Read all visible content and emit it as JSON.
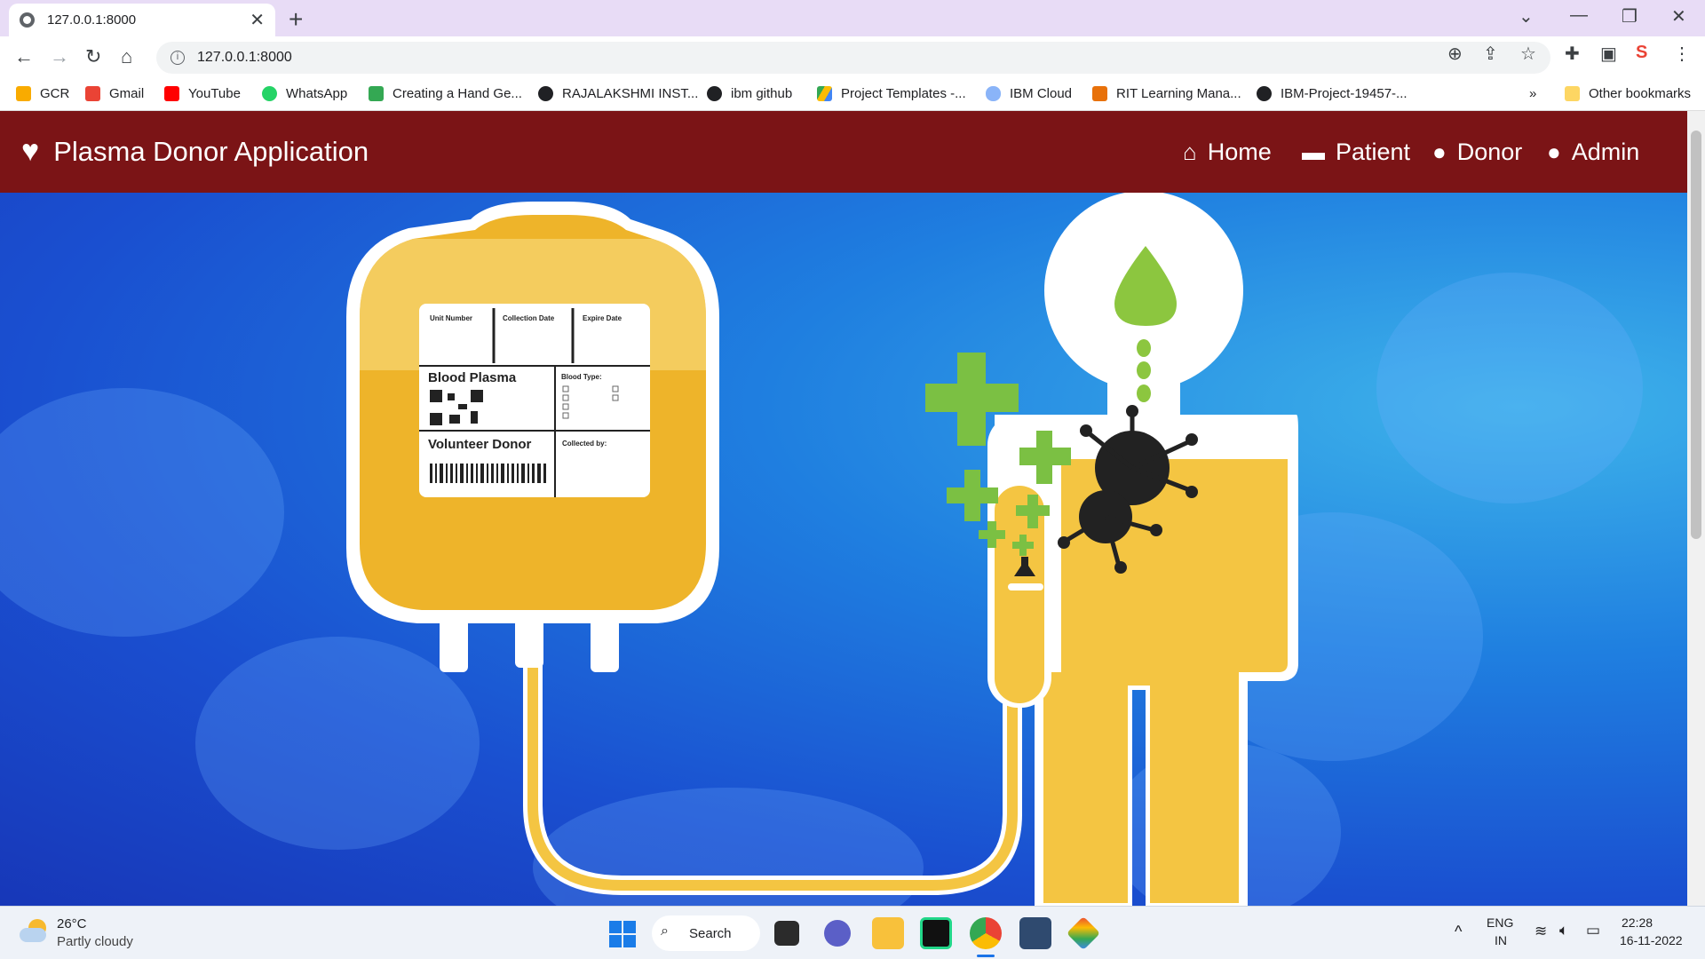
{
  "browser": {
    "tab_title": "127.0.0.1:8000",
    "url": "127.0.0.1:8000",
    "bookmarks": [
      {
        "label": "GCR",
        "color": "#f9ab00"
      },
      {
        "label": "Gmail",
        "color": "#ea4335"
      },
      {
        "label": "YouTube",
        "color": "#ff0000"
      },
      {
        "label": "WhatsApp",
        "color": "#25d366"
      },
      {
        "label": "Creating a Hand Ge...",
        "color": "#34a853"
      },
      {
        "label": "RAJALAKSHMI INST...",
        "color": "#202124"
      },
      {
        "label": "ibm github",
        "color": "#202124"
      },
      {
        "label": "Project Templates -...",
        "color": "#fbbc04"
      },
      {
        "label": "IBM Cloud",
        "color": "#8ab4f8"
      },
      {
        "label": "RIT Learning Mana...",
        "color": "#e8710a"
      },
      {
        "label": "IBM-Project-19457-...",
        "color": "#202124"
      }
    ],
    "more_bookmarks": "»",
    "other_bookmarks": "Other bookmarks"
  },
  "app": {
    "brand": "Plasma Donor Application",
    "nav": [
      {
        "label": "Home",
        "icon": "home-icon"
      },
      {
        "label": "Patient",
        "icon": "bed-icon"
      },
      {
        "label": "Donor",
        "icon": "user-icon"
      },
      {
        "label": "Admin",
        "icon": "user-cog-icon"
      }
    ],
    "colors": {
      "navbar": "#7b1416",
      "hero": "#1a4fd0",
      "plasma": "#f4c542"
    }
  },
  "hero_image": {
    "bag_label": {
      "unit_number": "Unit Number",
      "collection_date": "Collection Date",
      "expire_date": "Expire Date",
      "blood_plasma": "Blood Plasma",
      "blood_type": "Blood Type:",
      "volunteer_donor": "Volunteer Donor",
      "collected_by": "Collected by:"
    }
  },
  "taskbar": {
    "weather_temp": "26°C",
    "weather_desc": "Partly cloudy",
    "search": "Search",
    "lang_1": "ENG",
    "lang_2": "IN",
    "time": "22:28",
    "date": "16-11-2022"
  }
}
